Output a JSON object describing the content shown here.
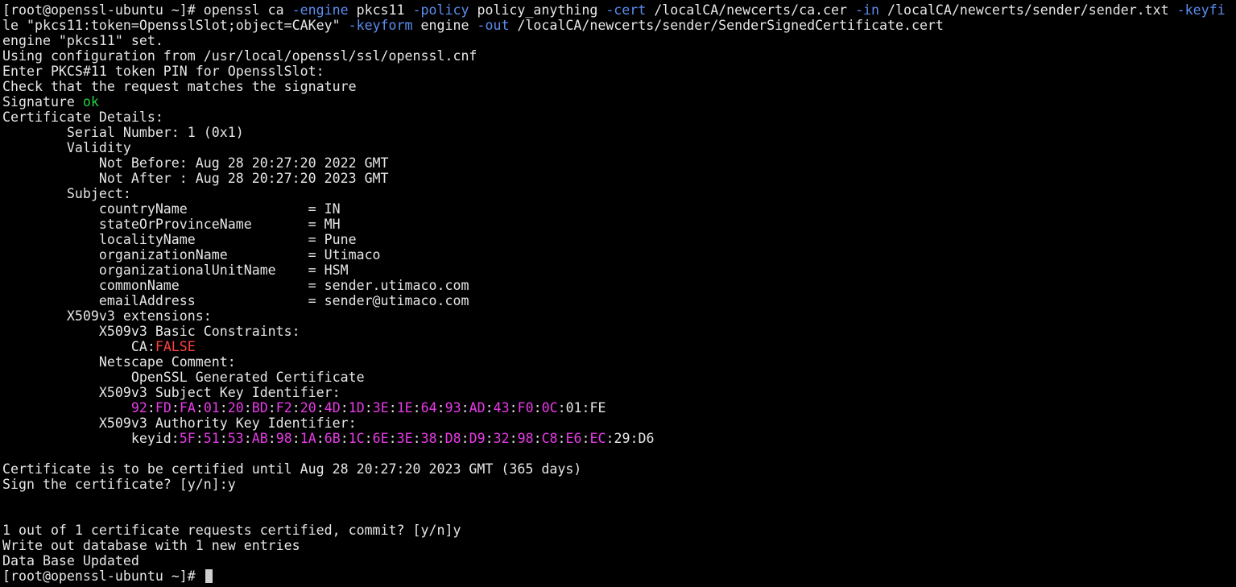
{
  "window": {
    "type": "terminal",
    "prompt": "[root@openssl-ubuntu ~]# "
  },
  "colors": {
    "background": "#000000",
    "default": "#e6e6e6",
    "option": "#5b8df0",
    "ok": "#27d03d",
    "false": "#ff4040",
    "magenta": "#e83be8",
    "cursor": "#cfcfcf"
  },
  "terminal": {
    "lines": [
      {
        "segments": [
          {
            "text": "[root@openssl-ubuntu ~]# openssl ca ",
            "style": "default"
          },
          {
            "text": "-engine",
            "style": "option"
          },
          {
            "text": " pkcs11 ",
            "style": "default"
          },
          {
            "text": "-policy",
            "style": "option"
          },
          {
            "text": " policy_anything ",
            "style": "default"
          },
          {
            "text": "-cert",
            "style": "option"
          },
          {
            "text": " /localCA/newcerts/ca.cer ",
            "style": "default"
          },
          {
            "text": "-in",
            "style": "option"
          },
          {
            "text": " /localCA/newcerts/sender/sender.txt ",
            "style": "default"
          },
          {
            "text": "-keyfi",
            "style": "option"
          }
        ]
      },
      {
        "segments": [
          {
            "text": "le \"pkcs11:token=OpensslSlot;object=CAKey\" ",
            "style": "default"
          },
          {
            "text": "-keyform",
            "style": "option"
          },
          {
            "text": " engine ",
            "style": "default"
          },
          {
            "text": "-out",
            "style": "option"
          },
          {
            "text": " /localCA/newcerts/sender/SenderSignedCertificate.cert",
            "style": "default"
          }
        ]
      },
      {
        "segments": [
          {
            "text": "engine \"pkcs11\" set.",
            "style": "default"
          }
        ]
      },
      {
        "segments": [
          {
            "text": "Using configuration from /usr/local/openssl/ssl/openssl.cnf",
            "style": "default"
          }
        ]
      },
      {
        "segments": [
          {
            "text": "Enter PKCS#11 token PIN for OpensslSlot:",
            "style": "default"
          }
        ]
      },
      {
        "segments": [
          {
            "text": "Check that the request matches the signature",
            "style": "default"
          }
        ]
      },
      {
        "segments": [
          {
            "text": "Signature ",
            "style": "default"
          },
          {
            "text": "ok",
            "style": "ok"
          }
        ]
      },
      {
        "segments": [
          {
            "text": "Certificate Details:",
            "style": "default"
          }
        ]
      },
      {
        "segments": [
          {
            "text": "        Serial Number: 1 (0x1)",
            "style": "default"
          }
        ]
      },
      {
        "segments": [
          {
            "text": "        Validity",
            "style": "default"
          }
        ]
      },
      {
        "segments": [
          {
            "text": "            Not Before: Aug 28 20:27:20 2022 GMT",
            "style": "default"
          }
        ]
      },
      {
        "segments": [
          {
            "text": "            Not After : Aug 28 20:27:20 2023 GMT",
            "style": "default"
          }
        ]
      },
      {
        "segments": [
          {
            "text": "        Subject:",
            "style": "default"
          }
        ]
      },
      {
        "segments": [
          {
            "text": "            countryName               = IN",
            "style": "default"
          }
        ]
      },
      {
        "segments": [
          {
            "text": "            stateOrProvinceName       = MH",
            "style": "default"
          }
        ]
      },
      {
        "segments": [
          {
            "text": "            localityName              = Pune",
            "style": "default"
          }
        ]
      },
      {
        "segments": [
          {
            "text": "            organizationName          = Utimaco",
            "style": "default"
          }
        ]
      },
      {
        "segments": [
          {
            "text": "            organizationalUnitName    = HSM",
            "style": "default"
          }
        ]
      },
      {
        "segments": [
          {
            "text": "            commonName                = sender.utimaco.com",
            "style": "default"
          }
        ]
      },
      {
        "segments": [
          {
            "text": "            emailAddress              = sender@utimaco.com",
            "style": "default"
          }
        ]
      },
      {
        "segments": [
          {
            "text": "        X509v3 extensions:",
            "style": "default"
          }
        ]
      },
      {
        "segments": [
          {
            "text": "            X509v3 Basic Constraints:",
            "style": "default"
          }
        ]
      },
      {
        "segments": [
          {
            "text": "                CA:",
            "style": "default"
          },
          {
            "text": "FALSE",
            "style": "false"
          }
        ]
      },
      {
        "segments": [
          {
            "text": "            Netscape Comment:",
            "style": "default"
          }
        ]
      },
      {
        "segments": [
          {
            "text": "                OpenSSL Generated Certificate",
            "style": "default"
          }
        ]
      },
      {
        "segments": [
          {
            "text": "            X509v3 Subject Key Identifier:",
            "style": "default"
          }
        ]
      },
      {
        "segments": [
          {
            "text": "                ",
            "style": "default"
          },
          {
            "text": "92",
            "style": "magenta"
          },
          {
            "text": ":",
            "style": "default"
          },
          {
            "text": "FD",
            "style": "magenta"
          },
          {
            "text": ":",
            "style": "default"
          },
          {
            "text": "FA",
            "style": "magenta"
          },
          {
            "text": ":",
            "style": "default"
          },
          {
            "text": "01",
            "style": "magenta"
          },
          {
            "text": ":",
            "style": "default"
          },
          {
            "text": "20",
            "style": "magenta"
          },
          {
            "text": ":",
            "style": "default"
          },
          {
            "text": "BD",
            "style": "magenta"
          },
          {
            "text": ":",
            "style": "default"
          },
          {
            "text": "F2",
            "style": "magenta"
          },
          {
            "text": ":",
            "style": "default"
          },
          {
            "text": "20",
            "style": "magenta"
          },
          {
            "text": ":",
            "style": "default"
          },
          {
            "text": "4D",
            "style": "magenta"
          },
          {
            "text": ":",
            "style": "default"
          },
          {
            "text": "1D",
            "style": "magenta"
          },
          {
            "text": ":",
            "style": "default"
          },
          {
            "text": "3E",
            "style": "magenta"
          },
          {
            "text": ":",
            "style": "default"
          },
          {
            "text": "1E",
            "style": "magenta"
          },
          {
            "text": ":",
            "style": "default"
          },
          {
            "text": "64",
            "style": "magenta"
          },
          {
            "text": ":",
            "style": "default"
          },
          {
            "text": "93",
            "style": "magenta"
          },
          {
            "text": ":",
            "style": "default"
          },
          {
            "text": "AD",
            "style": "magenta"
          },
          {
            "text": ":",
            "style": "default"
          },
          {
            "text": "43",
            "style": "magenta"
          },
          {
            "text": ":",
            "style": "default"
          },
          {
            "text": "F0",
            "style": "magenta"
          },
          {
            "text": ":",
            "style": "default"
          },
          {
            "text": "0C",
            "style": "magenta"
          },
          {
            "text": ":01:FE",
            "style": "default"
          }
        ]
      },
      {
        "segments": [
          {
            "text": "            X509v3 Authority Key Identifier:",
            "style": "default"
          }
        ]
      },
      {
        "segments": [
          {
            "text": "                keyid:",
            "style": "default"
          },
          {
            "text": "5F",
            "style": "magenta"
          },
          {
            "text": ":",
            "style": "default"
          },
          {
            "text": "51",
            "style": "magenta"
          },
          {
            "text": ":",
            "style": "default"
          },
          {
            "text": "53",
            "style": "magenta"
          },
          {
            "text": ":",
            "style": "default"
          },
          {
            "text": "AB",
            "style": "magenta"
          },
          {
            "text": ":",
            "style": "default"
          },
          {
            "text": "98",
            "style": "magenta"
          },
          {
            "text": ":",
            "style": "default"
          },
          {
            "text": "1A",
            "style": "magenta"
          },
          {
            "text": ":",
            "style": "default"
          },
          {
            "text": "6B",
            "style": "magenta"
          },
          {
            "text": ":",
            "style": "default"
          },
          {
            "text": "1C",
            "style": "magenta"
          },
          {
            "text": ":",
            "style": "default"
          },
          {
            "text": "6E",
            "style": "magenta"
          },
          {
            "text": ":",
            "style": "default"
          },
          {
            "text": "3E",
            "style": "magenta"
          },
          {
            "text": ":",
            "style": "default"
          },
          {
            "text": "38",
            "style": "magenta"
          },
          {
            "text": ":",
            "style": "default"
          },
          {
            "text": "D8",
            "style": "magenta"
          },
          {
            "text": ":",
            "style": "default"
          },
          {
            "text": "D9",
            "style": "magenta"
          },
          {
            "text": ":",
            "style": "default"
          },
          {
            "text": "32",
            "style": "magenta"
          },
          {
            "text": ":",
            "style": "default"
          },
          {
            "text": "98",
            "style": "magenta"
          },
          {
            "text": ":",
            "style": "default"
          },
          {
            "text": "C8",
            "style": "magenta"
          },
          {
            "text": ":",
            "style": "default"
          },
          {
            "text": "E6",
            "style": "magenta"
          },
          {
            "text": ":",
            "style": "default"
          },
          {
            "text": "EC",
            "style": "magenta"
          },
          {
            "text": ":29:D6",
            "style": "default"
          }
        ]
      },
      {
        "segments": [
          {
            "text": "",
            "style": "default"
          }
        ]
      },
      {
        "segments": [
          {
            "text": "Certificate is to be certified until Aug 28 20:27:20 2023 GMT (365 days)",
            "style": "default"
          }
        ]
      },
      {
        "segments": [
          {
            "text": "Sign the certificate? [y/n]:y",
            "style": "default"
          }
        ]
      },
      {
        "segments": [
          {
            "text": "",
            "style": "default"
          }
        ]
      },
      {
        "segments": [
          {
            "text": "",
            "style": "default"
          }
        ]
      },
      {
        "segments": [
          {
            "text": "1 out of 1 certificate requests certified, commit? [y/n]y",
            "style": "default"
          }
        ]
      },
      {
        "segments": [
          {
            "text": "Write out database with 1 new entries",
            "style": "default"
          }
        ]
      },
      {
        "segments": [
          {
            "text": "Data Base Updated",
            "style": "default"
          }
        ]
      },
      {
        "segments": [
          {
            "text": "[root@openssl-ubuntu ~]# ",
            "style": "default"
          }
        ],
        "cursor": true
      }
    ]
  }
}
